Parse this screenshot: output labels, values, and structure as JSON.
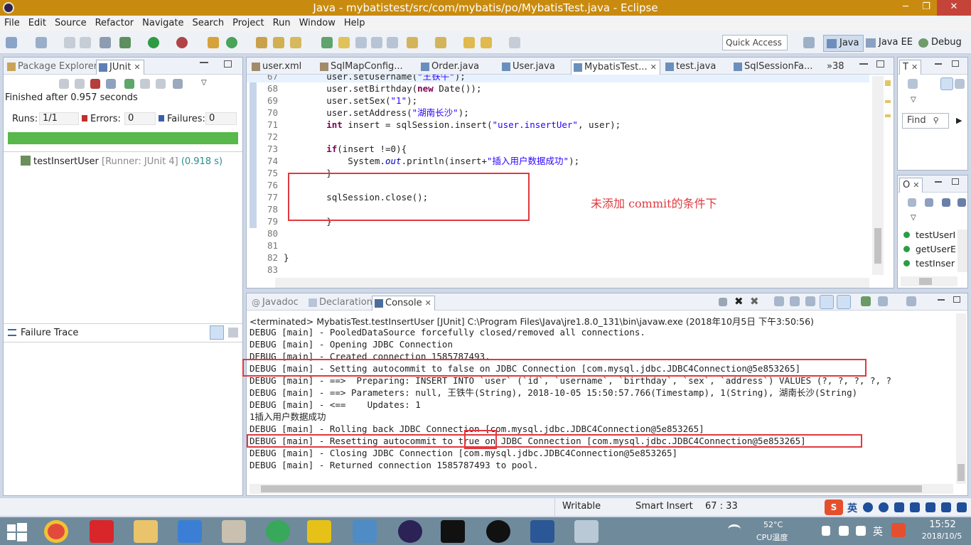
{
  "window": {
    "title": "Java - mybatistest/src/com/mybatis/po/MybatisTest.java - Eclipse",
    "minimize": "─",
    "maximize": "❐",
    "close": "✕"
  },
  "menu": [
    "File",
    "Edit",
    "Source",
    "Refactor",
    "Navigate",
    "Search",
    "Project",
    "Run",
    "Window",
    "Help"
  ],
  "toolbar": {
    "quick_access": "Quick Access",
    "perspectives": [
      "Java",
      "Java EE",
      "Debug"
    ]
  },
  "left_panel": {
    "tabs": [
      "Package Explorer",
      "JUnit"
    ],
    "status": "Finished after 0.957 seconds",
    "runs_label": "Runs:",
    "runs_value": "1/1",
    "errors_label": "Errors:",
    "errors_value": "0",
    "failures_label": "Failures:",
    "failures_value": "0",
    "progress": 1.0,
    "progress_color": "#58b84b",
    "test_name": "testInsertUser",
    "test_runner": "[Runner: JUnit 4]",
    "test_time": "(0.918 s)",
    "failure_trace_label": "Failure Trace"
  },
  "editor": {
    "tabs": [
      "user.xml",
      "SqlMapConfig...",
      "Order.java",
      "User.java",
      "MybatisTest...",
      "test.java",
      "SqlSessionFa...",
      "»38"
    ],
    "active_tab": "MybatisTest...",
    "lines": [
      {
        "n": "67",
        "text": "        user.setUsername(\"王铁牛\");"
      },
      {
        "n": "68",
        "text": "        user.setBirthday(new Date());"
      },
      {
        "n": "69",
        "text": "        user.setSex(\"1\");"
      },
      {
        "n": "70",
        "text": "        user.setAddress(\"湖南长沙\");"
      },
      {
        "n": "71",
        "text": "        int insert = sqlSession.insert(\"user.insertUer\", user);"
      },
      {
        "n": "72",
        "text": ""
      },
      {
        "n": "73",
        "text": "        if(insert !=0){"
      },
      {
        "n": "74",
        "text": "            System.out.println(insert+\"插入用户数据成功\");"
      },
      {
        "n": "75",
        "text": "        }"
      },
      {
        "n": "76",
        "text": ""
      },
      {
        "n": "77",
        "text": "        sqlSession.close();"
      },
      {
        "n": "78",
        "text": ""
      },
      {
        "n": "79",
        "text": "        }"
      },
      {
        "n": "80",
        "text": ""
      },
      {
        "n": "81",
        "text": ""
      },
      {
        "n": "82",
        "text": "}"
      },
      {
        "n": "83",
        "text": ""
      }
    ],
    "annotation": "未添加 commit的条件下"
  },
  "right_top": {
    "tab": "T",
    "find": "Find"
  },
  "outline": {
    "tab": "O",
    "items": [
      "testUserI",
      "getUserE",
      "testInser"
    ]
  },
  "console": {
    "tabs": [
      "Javadoc",
      "Declaration",
      "Console"
    ],
    "active_tab": "Console",
    "header": "<terminated> MybatisTest.testInsertUser [JUnit] C:\\Program Files\\Java\\jre1.8.0_131\\bin\\javaw.exe (2018年10月5日 下午3:50:56)",
    "lines": [
      "DEBUG [main] - PooledDataSource forcefully closed/removed all connections.",
      "DEBUG [main] - Opening JDBC Connection",
      "DEBUG [main] - Created connection 1585787493.",
      "DEBUG [main] - Setting autocommit to false on JDBC Connection [com.mysql.jdbc.JDBC4Connection@5e853265]",
      "DEBUG [main] - ==>  Preparing: INSERT INTO `user` (`id`, `username`, `birthday`, `sex`, `address`) VALUES (?, ?, ?, ?, ?",
      "DEBUG [main] - ==> Parameters: null, 王铁牛(String), 2018-10-05 15:50:57.766(Timestamp), 1(String), 湖南长沙(String)",
      "DEBUG [main] - <==    Updates: 1",
      "1插入用户数据成功",
      "DEBUG [main] - Rolling back JDBC Connection [com.mysql.jdbc.JDBC4Connection@5e853265]",
      "DEBUG [main] - Resetting autocommit to true on JDBC Connection [com.mysql.jdbc.JDBC4Connection@5e853265]",
      "DEBUG [main] - Closing JDBC Connection [com.mysql.jdbc.JDBC4Connection@5e853265]",
      "DEBUG [main] - Returned connection 1585787493 to pool."
    ]
  },
  "statusbar": {
    "writable": "Writable",
    "insert_mode": "Smart Insert",
    "position": "67 : 33"
  },
  "taskbar": {
    "temp": "52°C",
    "cpu": "CPU温度",
    "time": "15:52",
    "date": "2018/10/5",
    "ime": "英"
  }
}
